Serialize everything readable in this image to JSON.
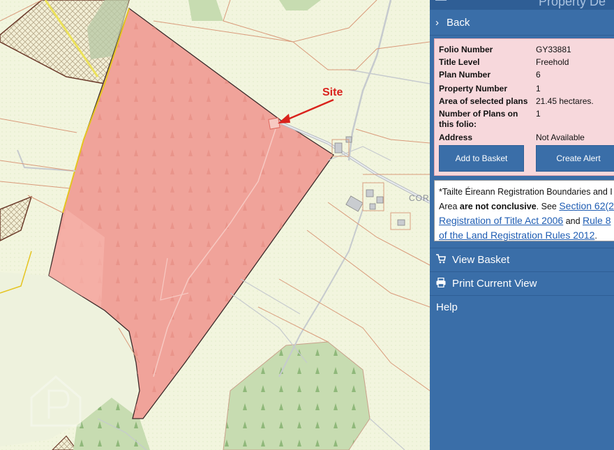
{
  "map": {
    "site_label": "Site",
    "place_label": "COR"
  },
  "panel": {
    "title": "Property De",
    "back_label": "Back",
    "details": [
      {
        "key": "Folio Number",
        "value": "GY33881"
      },
      {
        "key": "Title Level",
        "value": "Freehold"
      },
      {
        "key": "Plan Number",
        "value": "6"
      },
      {
        "key": "Property Number",
        "value": "1"
      },
      {
        "key": "Area of selected plans",
        "value": "21.45 hectares."
      },
      {
        "key": "Number of Plans on this folio:",
        "value": "1"
      },
      {
        "key": "Address",
        "value": "Not Available"
      }
    ],
    "add_to_basket_label": "Add to Basket",
    "create_alert_label": "Create Alert",
    "notice": {
      "line1": "*Tailte Éireann Registration Boundaries and I",
      "line2_pre": "Area ",
      "line2_bold": "are not conclusive",
      "line2_mid": ". See ",
      "line2_link": "Section 62(2",
      "line3_link": "Registration of Title Act 2006",
      "line3_mid": " and ",
      "line3_link2": "Rule 8",
      "line4_link": "of the Land Registration Rules 2012",
      "line4_end": "."
    },
    "view_basket_label": "View Basket",
    "print_label": "Print Current View",
    "help_label": "Help"
  },
  "colors": {
    "panel_bg": "#3a6ea8",
    "site_parcel": "#f0a39a",
    "site_label": "#d9221c",
    "details_bg": "#f7d8dc"
  },
  "icons": {
    "menu": "hamburger-icon",
    "back": "chevron-right-icon",
    "basket": "shopping-cart-icon",
    "print": "printer-icon"
  }
}
